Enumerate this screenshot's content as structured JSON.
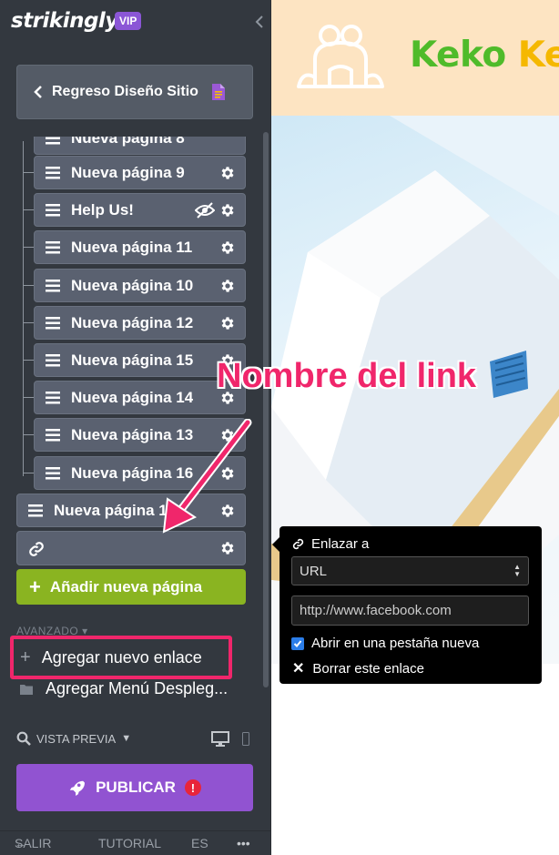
{
  "sidebar": {
    "logo": "strikingly",
    "vip_badge": "VIP",
    "back_label": "Regreso Diseño Sitio",
    "cut_item_label": "Nueva página 8",
    "pages": [
      {
        "label": "Nueva página 9",
        "hidden": false
      },
      {
        "label": "Help Us!",
        "hidden": true
      },
      {
        "label": "Nueva página 11",
        "hidden": false
      },
      {
        "label": "Nueva página 10",
        "hidden": false
      },
      {
        "label": "Nueva página 12",
        "hidden": false
      },
      {
        "label": "Nueva página 15",
        "hidden": false
      },
      {
        "label": "Nueva página 14",
        "hidden": false
      },
      {
        "label": "Nueva página 13",
        "hidden": false
      },
      {
        "label": "Nueva página 16",
        "hidden": false
      }
    ],
    "top_page_label": "Nueva página 1",
    "add_page_label": "Añadir nueva página",
    "advanced_label": "AVANZADO",
    "add_link_label": "Agregar nuevo enlace",
    "add_menu_label": "Agregar Menú Despleg...",
    "preview_label": "VISTA PREVIA",
    "publish_label": "PUBLICAR",
    "publish_alert": "!",
    "footer": {
      "exit": "SALIR",
      "tutorial": "TUTORIAL",
      "language": "ES",
      "more": "•••"
    }
  },
  "site": {
    "brand_green": "Keko",
    "brand_yellow": "Ke"
  },
  "annotation": {
    "text": "Nombre del link",
    "color": "#f0266b"
  },
  "link_popover": {
    "title": "Enlazar a",
    "link_type": "URL",
    "url_value": "http://www.facebook.com",
    "new_tab_label": "Abrir en una pestaña nueva",
    "new_tab_checked": true,
    "delete_label": "Borrar este enlace"
  },
  "colors": {
    "sidebar_bg": "#33383f",
    "page_item_bg": "#5a6170",
    "add_page_green": "#8ab421",
    "publish_purple": "#9153d1",
    "vip_purple": "#8b56d6",
    "highlight_pink": "#f0266b",
    "header_peach": "#fde4c2"
  }
}
